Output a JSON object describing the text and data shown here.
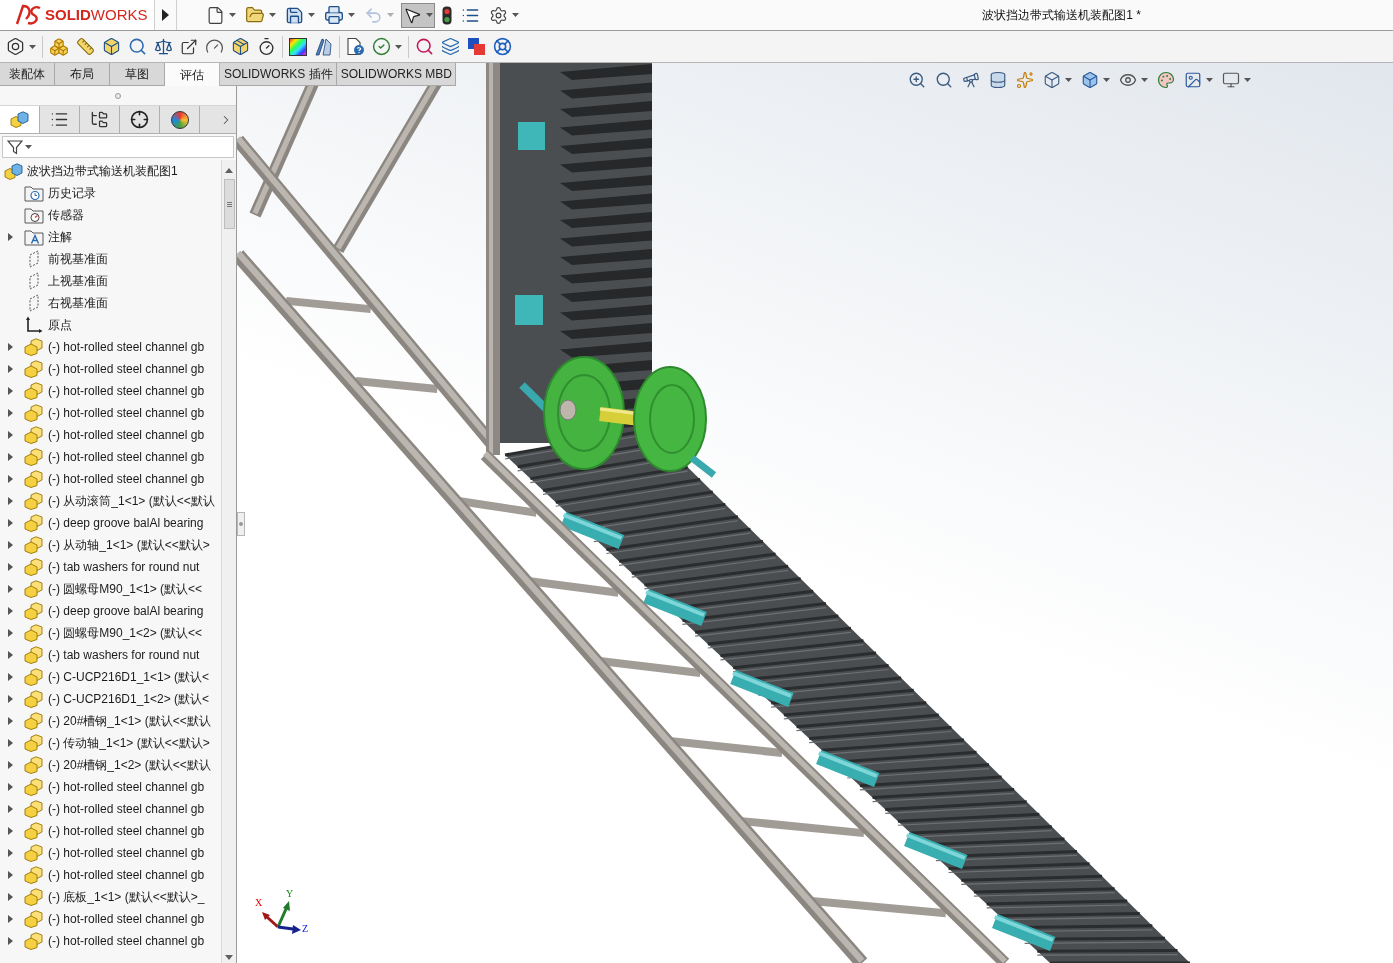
{
  "app": {
    "brand": "**SOLID**WORKS",
    "title": "波状挡边带式输送机装配图1 *"
  },
  "quick_toolbar": [
    {
      "kind": "new",
      "dropdown": true,
      "disabled": false,
      "active": false
    },
    {
      "kind": "open",
      "dropdown": true,
      "disabled": false,
      "active": false
    },
    {
      "kind": "save",
      "dropdown": true,
      "disabled": false,
      "active": false
    },
    {
      "kind": "print",
      "dropdown": true,
      "disabled": false,
      "active": false
    },
    {
      "kind": "undo",
      "dropdown": true,
      "disabled": true,
      "active": false
    },
    {
      "kind": "select",
      "dropdown": true,
      "disabled": false,
      "active": true
    },
    {
      "kind": "rebuild",
      "dropdown": false,
      "disabled": false,
      "active": false
    },
    {
      "kind": "file-properties",
      "dropdown": false,
      "disabled": false,
      "active": false
    },
    {
      "kind": "options",
      "dropdown": true,
      "disabled": false,
      "active": false
    }
  ],
  "command_groups": [
    [
      {
        "kind": "fastener",
        "dropdown": true
      }
    ],
    [
      {
        "kind": "interference",
        "dropdown": false
      },
      {
        "kind": "clearance",
        "dropdown": false
      },
      {
        "kind": "hole-alignment",
        "dropdown": false
      },
      {
        "kind": "measure",
        "dropdown": false
      },
      {
        "kind": "mass",
        "dropdown": false
      },
      {
        "kind": "reference",
        "dropdown": false
      },
      {
        "kind": "sensor",
        "dropdown": false
      },
      {
        "kind": "visualization",
        "dropdown": false
      },
      {
        "kind": "performance",
        "dropdown": false
      }
    ],
    [
      {
        "kind": "curvature",
        "dropdown": false
      },
      {
        "kind": "draft",
        "dropdown": false
      }
    ],
    [
      {
        "kind": "diagnose",
        "dropdown": false
      },
      {
        "kind": "symmetry",
        "dropdown": true
      }
    ],
    [
      {
        "kind": "analysis",
        "dropdown": false
      },
      {
        "kind": "thickness",
        "dropdown": false
      },
      {
        "kind": "export",
        "dropdown": false
      },
      {
        "kind": "compare",
        "dropdown": false
      }
    ]
  ],
  "tabs": [
    {
      "label": "装配体",
      "selected": false
    },
    {
      "label": "布局",
      "selected": false
    },
    {
      "label": "草图",
      "selected": false
    },
    {
      "label": "评估",
      "selected": true
    },
    {
      "label": "SOLIDWORKS 插件",
      "selected": false
    },
    {
      "label": "SOLIDWORKS MBD",
      "selected": false
    }
  ],
  "panel_tabs": [
    {
      "kind": "feature-manager",
      "selected": true
    },
    {
      "kind": "property-manager",
      "selected": false
    },
    {
      "kind": "configuration-manager",
      "selected": false
    },
    {
      "kind": "dimxpert",
      "selected": false
    },
    {
      "kind": "display-manager",
      "selected": false
    }
  ],
  "feature_tree": {
    "kind": "assembly",
    "label": "波状挡边带式输送机装配图1",
    "children": [
      {
        "kind": "history",
        "label": "历史记录",
        "expandable": false
      },
      {
        "kind": "sensors",
        "label": "传感器",
        "expandable": false
      },
      {
        "kind": "annotations",
        "label": "注解",
        "expandable": true
      },
      {
        "kind": "plane",
        "label": "前视基准面",
        "expandable": false
      },
      {
        "kind": "plane",
        "label": "上视基准面",
        "expandable": false
      },
      {
        "kind": "plane",
        "label": "右视基准面",
        "expandable": false
      },
      {
        "kind": "origin",
        "label": "原点",
        "expandable": false
      },
      {
        "kind": "component",
        "label": "(-) hot-rolled steel channel gb",
        "expandable": true
      },
      {
        "kind": "component",
        "label": "(-) hot-rolled steel channel gb",
        "expandable": true
      },
      {
        "kind": "component",
        "label": "(-) hot-rolled steel channel gb",
        "expandable": true
      },
      {
        "kind": "component",
        "label": "(-) hot-rolled steel channel gb",
        "expandable": true
      },
      {
        "kind": "component",
        "label": "(-) hot-rolled steel channel gb",
        "expandable": true
      },
      {
        "kind": "component",
        "label": "(-) hot-rolled steel channel gb",
        "expandable": true
      },
      {
        "kind": "component",
        "label": "(-) hot-rolled steel channel gb",
        "expandable": true
      },
      {
        "kind": "component",
        "label": "(-) 从动滚筒_1<1> (默认<<默认",
        "expandable": true
      },
      {
        "kind": "component",
        "label": "(-) deep groove balAl bearing",
        "expandable": true
      },
      {
        "kind": "component",
        "label": "(-) 从动轴_1<1> (默认<<默认>",
        "expandable": true
      },
      {
        "kind": "component",
        "label": "(-) tab washers for round nut",
        "expandable": true
      },
      {
        "kind": "component",
        "label": "(-) 圆螺母M90_1<1> (默认<<",
        "expandable": true
      },
      {
        "kind": "component",
        "label": "(-) deep groove balAl bearing",
        "expandable": true
      },
      {
        "kind": "component",
        "label": "(-) 圆螺母M90_1<2> (默认<<",
        "expandable": true
      },
      {
        "kind": "component",
        "label": "(-) tab washers for round nut",
        "expandable": true
      },
      {
        "kind": "component",
        "label": "(-) C-UCP216D1_1<1> (默认<",
        "expandable": true
      },
      {
        "kind": "component",
        "label": "(-) C-UCP216D1_1<2> (默认<",
        "expandable": true
      },
      {
        "kind": "component",
        "label": "(-) 20#槽钢_1<1> (默认<<默认",
        "expandable": true
      },
      {
        "kind": "component",
        "label": "(-) 传动轴_1<1> (默认<<默认>",
        "expandable": true
      },
      {
        "kind": "component",
        "label": "(-) 20#槽钢_1<2> (默认<<默认",
        "expandable": true
      },
      {
        "kind": "component",
        "label": "(-) hot-rolled steel channel gb",
        "expandable": true
      },
      {
        "kind": "component",
        "label": "(-) hot-rolled steel channel gb",
        "expandable": true
      },
      {
        "kind": "component",
        "label": "(-) hot-rolled steel channel gb",
        "expandable": true
      },
      {
        "kind": "component",
        "label": "(-) hot-rolled steel channel gb",
        "expandable": true
      },
      {
        "kind": "component",
        "label": "(-) hot-rolled steel channel gb",
        "expandable": true
      },
      {
        "kind": "component",
        "label": "(-) 底板_1<1> (默认<<默认>_",
        "expandable": true
      },
      {
        "kind": "component",
        "label": "(-) hot-rolled steel channel gb",
        "expandable": true
      },
      {
        "kind": "component",
        "label": "(-) hot-rolled steel channel gb",
        "expandable": true
      }
    ]
  },
  "viewport": {
    "heads_up_toolbar": [
      {
        "kind": "zoom-fit",
        "dropdown": false
      },
      {
        "kind": "zoom-area",
        "dropdown": false
      },
      {
        "kind": "previous-view",
        "dropdown": false
      },
      {
        "kind": "section-view",
        "dropdown": false
      },
      {
        "kind": "annotation-view",
        "dropdown": false
      },
      {
        "kind": "view-orientation",
        "dropdown": true
      },
      {
        "kind": "display-style",
        "dropdown": true
      },
      {
        "kind": "hide-show",
        "dropdown": true
      },
      {
        "kind": "appearance",
        "dropdown": false
      },
      {
        "kind": "scene",
        "dropdown": true
      },
      {
        "kind": "view-settings",
        "dropdown": true
      }
    ],
    "triad": {
      "x": "X",
      "y": "Y",
      "z": "Z"
    }
  }
}
